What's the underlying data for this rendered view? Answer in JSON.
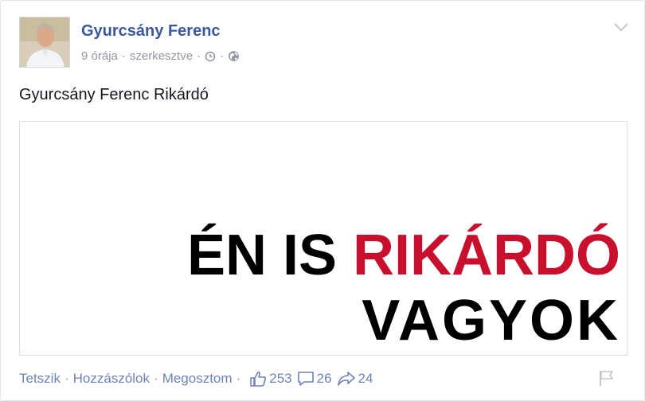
{
  "post": {
    "author": "Gyurcsány Ferenc",
    "time": "9 órája",
    "edited": "szerkesztve",
    "text": "Gyurcsány Ferenc Rikárdó"
  },
  "image": {
    "line1_black": "ÉN IS ",
    "line1_red": "RIKÁRDÓ",
    "line2": "VAGYOK",
    "accent_color": "#c8102e"
  },
  "actions": {
    "like": "Tetszik",
    "comment": "Hozzászólok",
    "share": "Megosztom"
  },
  "stats": {
    "likes": "253",
    "comments": "26",
    "shares": "24"
  },
  "icons": {
    "chevron": "chevron-down-icon",
    "clock": "clock-icon",
    "globe": "globe-icon",
    "like": "thumbs-up-icon",
    "comment": "comment-icon",
    "share": "share-icon",
    "flag": "flag-icon"
  }
}
